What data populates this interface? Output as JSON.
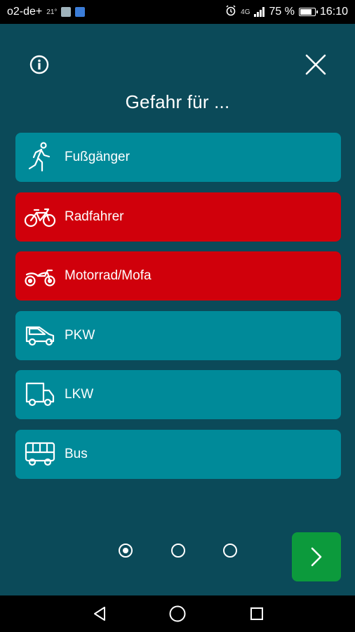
{
  "status_bar": {
    "carrier": "o2-de+",
    "temperature": "21°",
    "network": "4G",
    "battery": "75 %",
    "time": "16:10"
  },
  "header": {
    "title": "Gefahr für ..."
  },
  "options": [
    {
      "label": "Fußgänger",
      "icon": "pedestrian-icon",
      "selected": false
    },
    {
      "label": "Radfahrer",
      "icon": "bicycle-icon",
      "selected": true
    },
    {
      "label": "Motorrad/Mofa",
      "icon": "motorcycle-icon",
      "selected": true
    },
    {
      "label": "PKW",
      "icon": "car-icon",
      "selected": false
    },
    {
      "label": "LKW",
      "icon": "truck-icon",
      "selected": false
    },
    {
      "label": "Bus",
      "icon": "bus-icon",
      "selected": false
    }
  ],
  "pager": {
    "pages": 3,
    "current": 1
  },
  "colors": {
    "background": "#0b4a59",
    "item": "#008a99",
    "item_selected": "#d0000b",
    "next_button": "#0c9a3c"
  }
}
